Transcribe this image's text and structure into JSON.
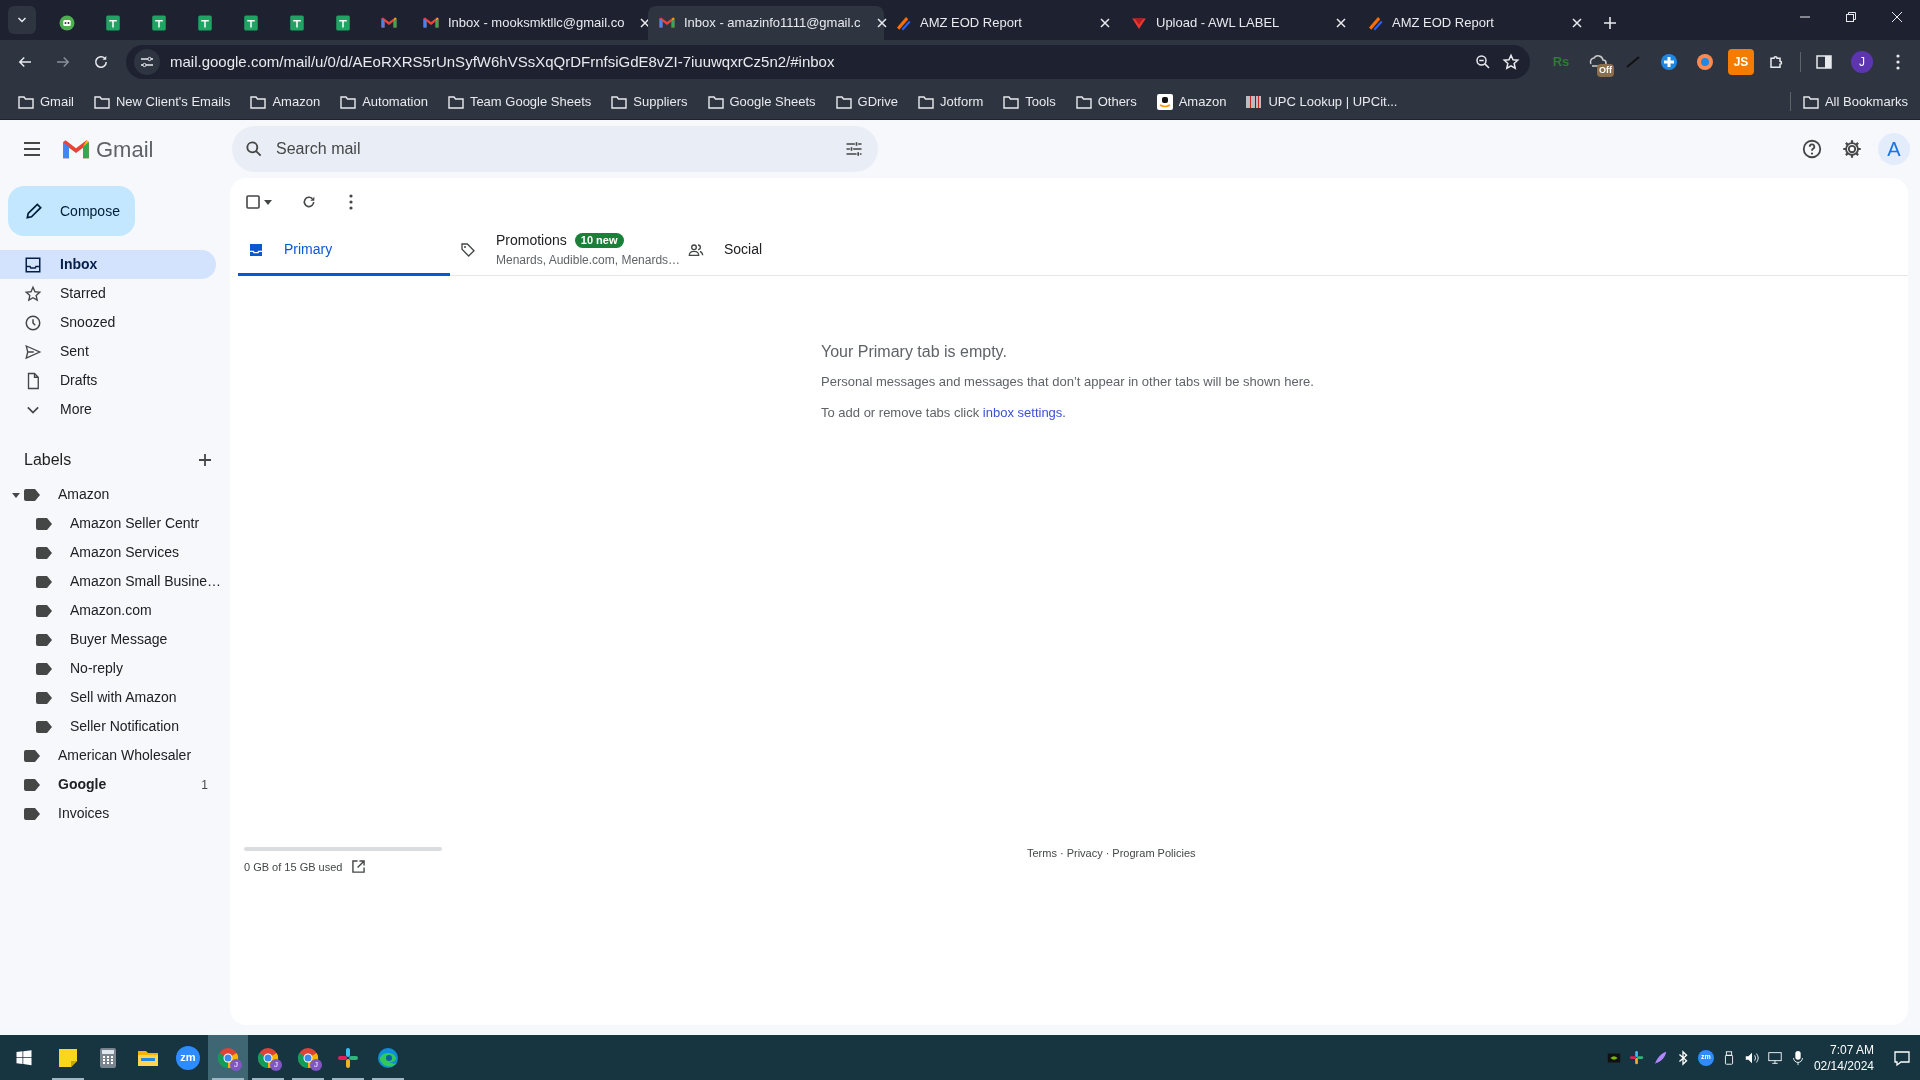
{
  "browser": {
    "tabs": [
      {
        "kind": "robot",
        "selected": false
      },
      {
        "kind": "sheets",
        "selected": false
      },
      {
        "kind": "sheets",
        "selected": false
      },
      {
        "kind": "sheets",
        "selected": false
      },
      {
        "kind": "sheets",
        "selected": false
      },
      {
        "kind": "sheets",
        "selected": false
      },
      {
        "kind": "sheets",
        "selected": false
      },
      {
        "kind": "gmail",
        "selected": false
      },
      {
        "kind": "gmail",
        "title": "Inbox - mooksmktllc@gmail.co",
        "selected": false
      },
      {
        "kind": "gmail",
        "title": "Inbox - amazinfo1111@gmail.c",
        "selected": true
      },
      {
        "kind": "amz",
        "title": "AMZ EOD Report",
        "selected": false
      },
      {
        "kind": "upload",
        "title": "Upload - AWL LABEL",
        "selected": false
      },
      {
        "kind": "amz",
        "title": "AMZ EOD Report",
        "selected": false
      }
    ],
    "url": "mail.google.com/mail/u/0/d/AEoRXRS5rUnSyfW6hVSsXqQrDFrnfsiGdE8vZI-7iuuwqxrCz5n2/#inbox",
    "extensions": [
      {
        "kind": "rs",
        "label": "Rs"
      },
      {
        "kind": "off",
        "label": "Off"
      },
      {
        "kind": "pen"
      },
      {
        "kind": "cross"
      },
      {
        "kind": "orb"
      },
      {
        "kind": "js",
        "label": "JS"
      },
      {
        "kind": "puzzle"
      }
    ],
    "profile": "J",
    "bookmarks": [
      {
        "kind": "folder",
        "label": "Gmail"
      },
      {
        "kind": "folder",
        "label": "New Client's Emails"
      },
      {
        "kind": "folder",
        "label": "Amazon"
      },
      {
        "kind": "folder",
        "label": "Automation"
      },
      {
        "kind": "folder",
        "label": "Team Google Sheets"
      },
      {
        "kind": "folder",
        "label": "Suppliers"
      },
      {
        "kind": "folder",
        "label": "Google Sheets"
      },
      {
        "kind": "folder",
        "label": "GDrive"
      },
      {
        "kind": "folder",
        "label": "Jotform"
      },
      {
        "kind": "folder",
        "label": "Tools"
      },
      {
        "kind": "folder",
        "label": "Others"
      },
      {
        "kind": "amazon",
        "label": "Amazon"
      },
      {
        "kind": "barcode",
        "label": "UPC Lookup | UPCit..."
      }
    ],
    "all_bookmarks": "All Bookmarks"
  },
  "gmail": {
    "logo": "Gmail",
    "search": {
      "placeholder": "Search mail"
    },
    "account": "A",
    "compose": "Compose",
    "select_all": {
      "checked": false
    },
    "nav": [
      {
        "kind": "inbox",
        "label": "Inbox",
        "selected": true
      },
      {
        "kind": "star",
        "label": "Starred",
        "selected": false
      },
      {
        "kind": "clock",
        "label": "Snoozed",
        "selected": false
      },
      {
        "kind": "send",
        "label": "Sent",
        "selected": false
      },
      {
        "kind": "draft",
        "label": "Drafts",
        "selected": false
      },
      {
        "kind": "more",
        "label": "More",
        "selected": false
      }
    ],
    "labels_heading": "Labels",
    "labels": [
      {
        "label": "Amazon",
        "unread": false,
        "expanded": true,
        "children": [
          {
            "label": "Amazon Seller Centr",
            "unread": false
          },
          {
            "label": "Amazon Services",
            "unread": false
          },
          {
            "label": "Amazon Small Busine…",
            "unread": false
          },
          {
            "label": "Amazon.com",
            "unread": false
          },
          {
            "label": "Buyer Message",
            "unread": false
          },
          {
            "label": "No-reply",
            "unread": false
          },
          {
            "label": "Sell with Amazon",
            "unread": false
          },
          {
            "label": "Seller Notification",
            "unread": false
          }
        ]
      },
      {
        "label": "American Wholesaler",
        "unread": false
      },
      {
        "label": "Google",
        "unread": true,
        "count": "1"
      },
      {
        "label": "Invoices",
        "unread": false
      }
    ],
    "inbox_tabs": [
      {
        "kind": "inbox",
        "label": "Primary",
        "selected": true
      },
      {
        "kind": "tag",
        "label": "Promotions",
        "badge": "10 new",
        "snippet": "Menards, Audible.com, Menards…",
        "selected": false
      },
      {
        "kind": "people",
        "label": "Social",
        "selected": false
      }
    ],
    "empty": {
      "title": "Your Primary tab is empty.",
      "text": "Personal messages and messages that don’t appear in other tabs will be shown here.",
      "hint": "To add or remove tabs click ",
      "link": "inbox settings",
      "end": "."
    },
    "storage": {
      "level": 0,
      "text": "0 GB of 15 GB used"
    },
    "footer": {
      "links": [
        "Terms",
        "Privacy",
        "Program Policies"
      ],
      "separator": "·"
    }
  },
  "taskbar": {
    "apps": [
      {
        "kind": "windows",
        "open": false,
        "selected": false
      },
      {
        "kind": "sticky",
        "open": true,
        "selected": false
      },
      {
        "kind": "calculator",
        "open": false,
        "selected": false
      },
      {
        "kind": "explorer",
        "open": false,
        "selected": false
      },
      {
        "kind": "zoom",
        "label": "zm",
        "open": false,
        "selected": false
      },
      {
        "kind": "chrome",
        "badge": "J",
        "open": true,
        "selected": true
      },
      {
        "kind": "chrome",
        "badge": "J",
        "open": true,
        "selected": false
      },
      {
        "kind": "chrome",
        "badge": "J",
        "open": true,
        "selected": false
      },
      {
        "kind": "slack",
        "open": true,
        "selected": false
      },
      {
        "kind": "edge",
        "open": true,
        "selected": false
      }
    ],
    "tray": [
      {
        "kind": "nvidia"
      },
      {
        "kind": "slack"
      },
      {
        "kind": "feather"
      },
      {
        "kind": "bluetooth"
      },
      {
        "kind": "zoom",
        "label": "zm"
      },
      {
        "kind": "usb"
      },
      {
        "kind": "volume"
      },
      {
        "kind": "network"
      },
      {
        "kind": "mic"
      }
    ],
    "time": "7:07 AM",
    "date": "02/14/2024"
  }
}
